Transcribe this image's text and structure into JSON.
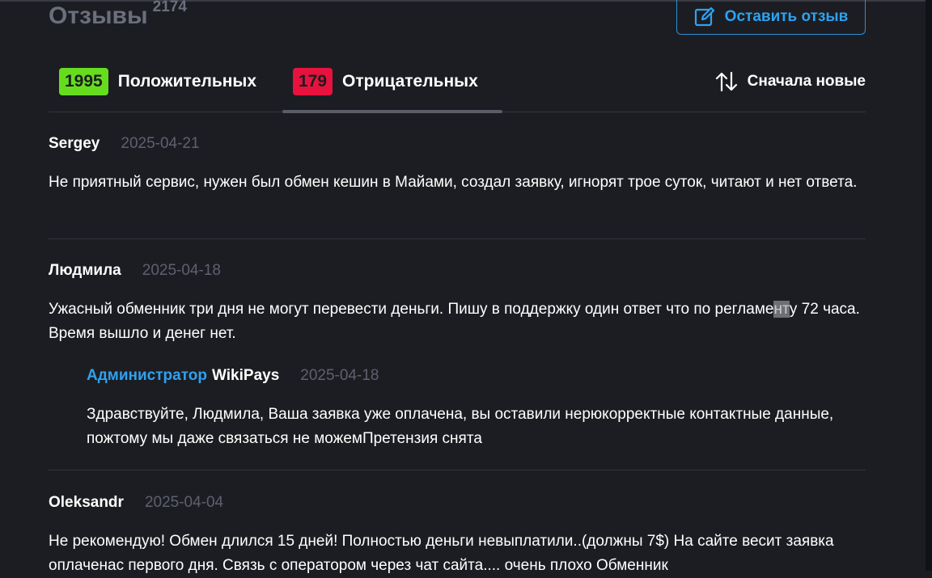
{
  "header": {
    "title": "Отзывы",
    "total": "2174",
    "write_button": "Оставить отзыв"
  },
  "tabs": {
    "positive": {
      "count": "1995",
      "label": "Положительных"
    },
    "negative": {
      "count": "179",
      "label": "Отрицательных"
    }
  },
  "sort": {
    "label": "Сначала новые"
  },
  "reviews": [
    {
      "author": "Sergey",
      "date": "2025-04-21",
      "text": "Не приятный сервис, нужен был обмен кешин в Майами, создал заявку, игнорят трое суток, читают и нет ответа."
    },
    {
      "author": "Людмила",
      "date": "2025-04-18",
      "text_a": "Ужасный обменник три дня не могут перевести деньги. Пишу в поддержку один ответ что по регламе",
      "text_hl": "нт",
      "text_b": "у 72 часа. Время вышло и денег нет.",
      "reply": {
        "role": "Администратор",
        "name": "WikiPays",
        "date": "2025-04-18",
        "text": "Здравствуйте, Людмила, Ваша заявка уже оплачена, вы оставили нерюкорректные контактные данные, пожтому мы даже связаться не можемПретензия снята"
      }
    },
    {
      "author": "Oleksandr",
      "date": "2025-04-04",
      "text": "Не рекомендую! Обмен длился 15 дней! Полностью деньги невыплатили..(должны 7$) На сайте весит заявка оплаченас первого дня. Связь с оператором через чат сайта.... очень плохо Обменник"
    }
  ],
  "colors": {
    "background": "#1c1d22",
    "accent": "#2ea2f0",
    "positive": "#66dc1e",
    "negative": "#e8123e",
    "muted": "#5e6070"
  },
  "icons": {
    "write": "edit-icon",
    "sort": "sort-arrows-icon"
  }
}
